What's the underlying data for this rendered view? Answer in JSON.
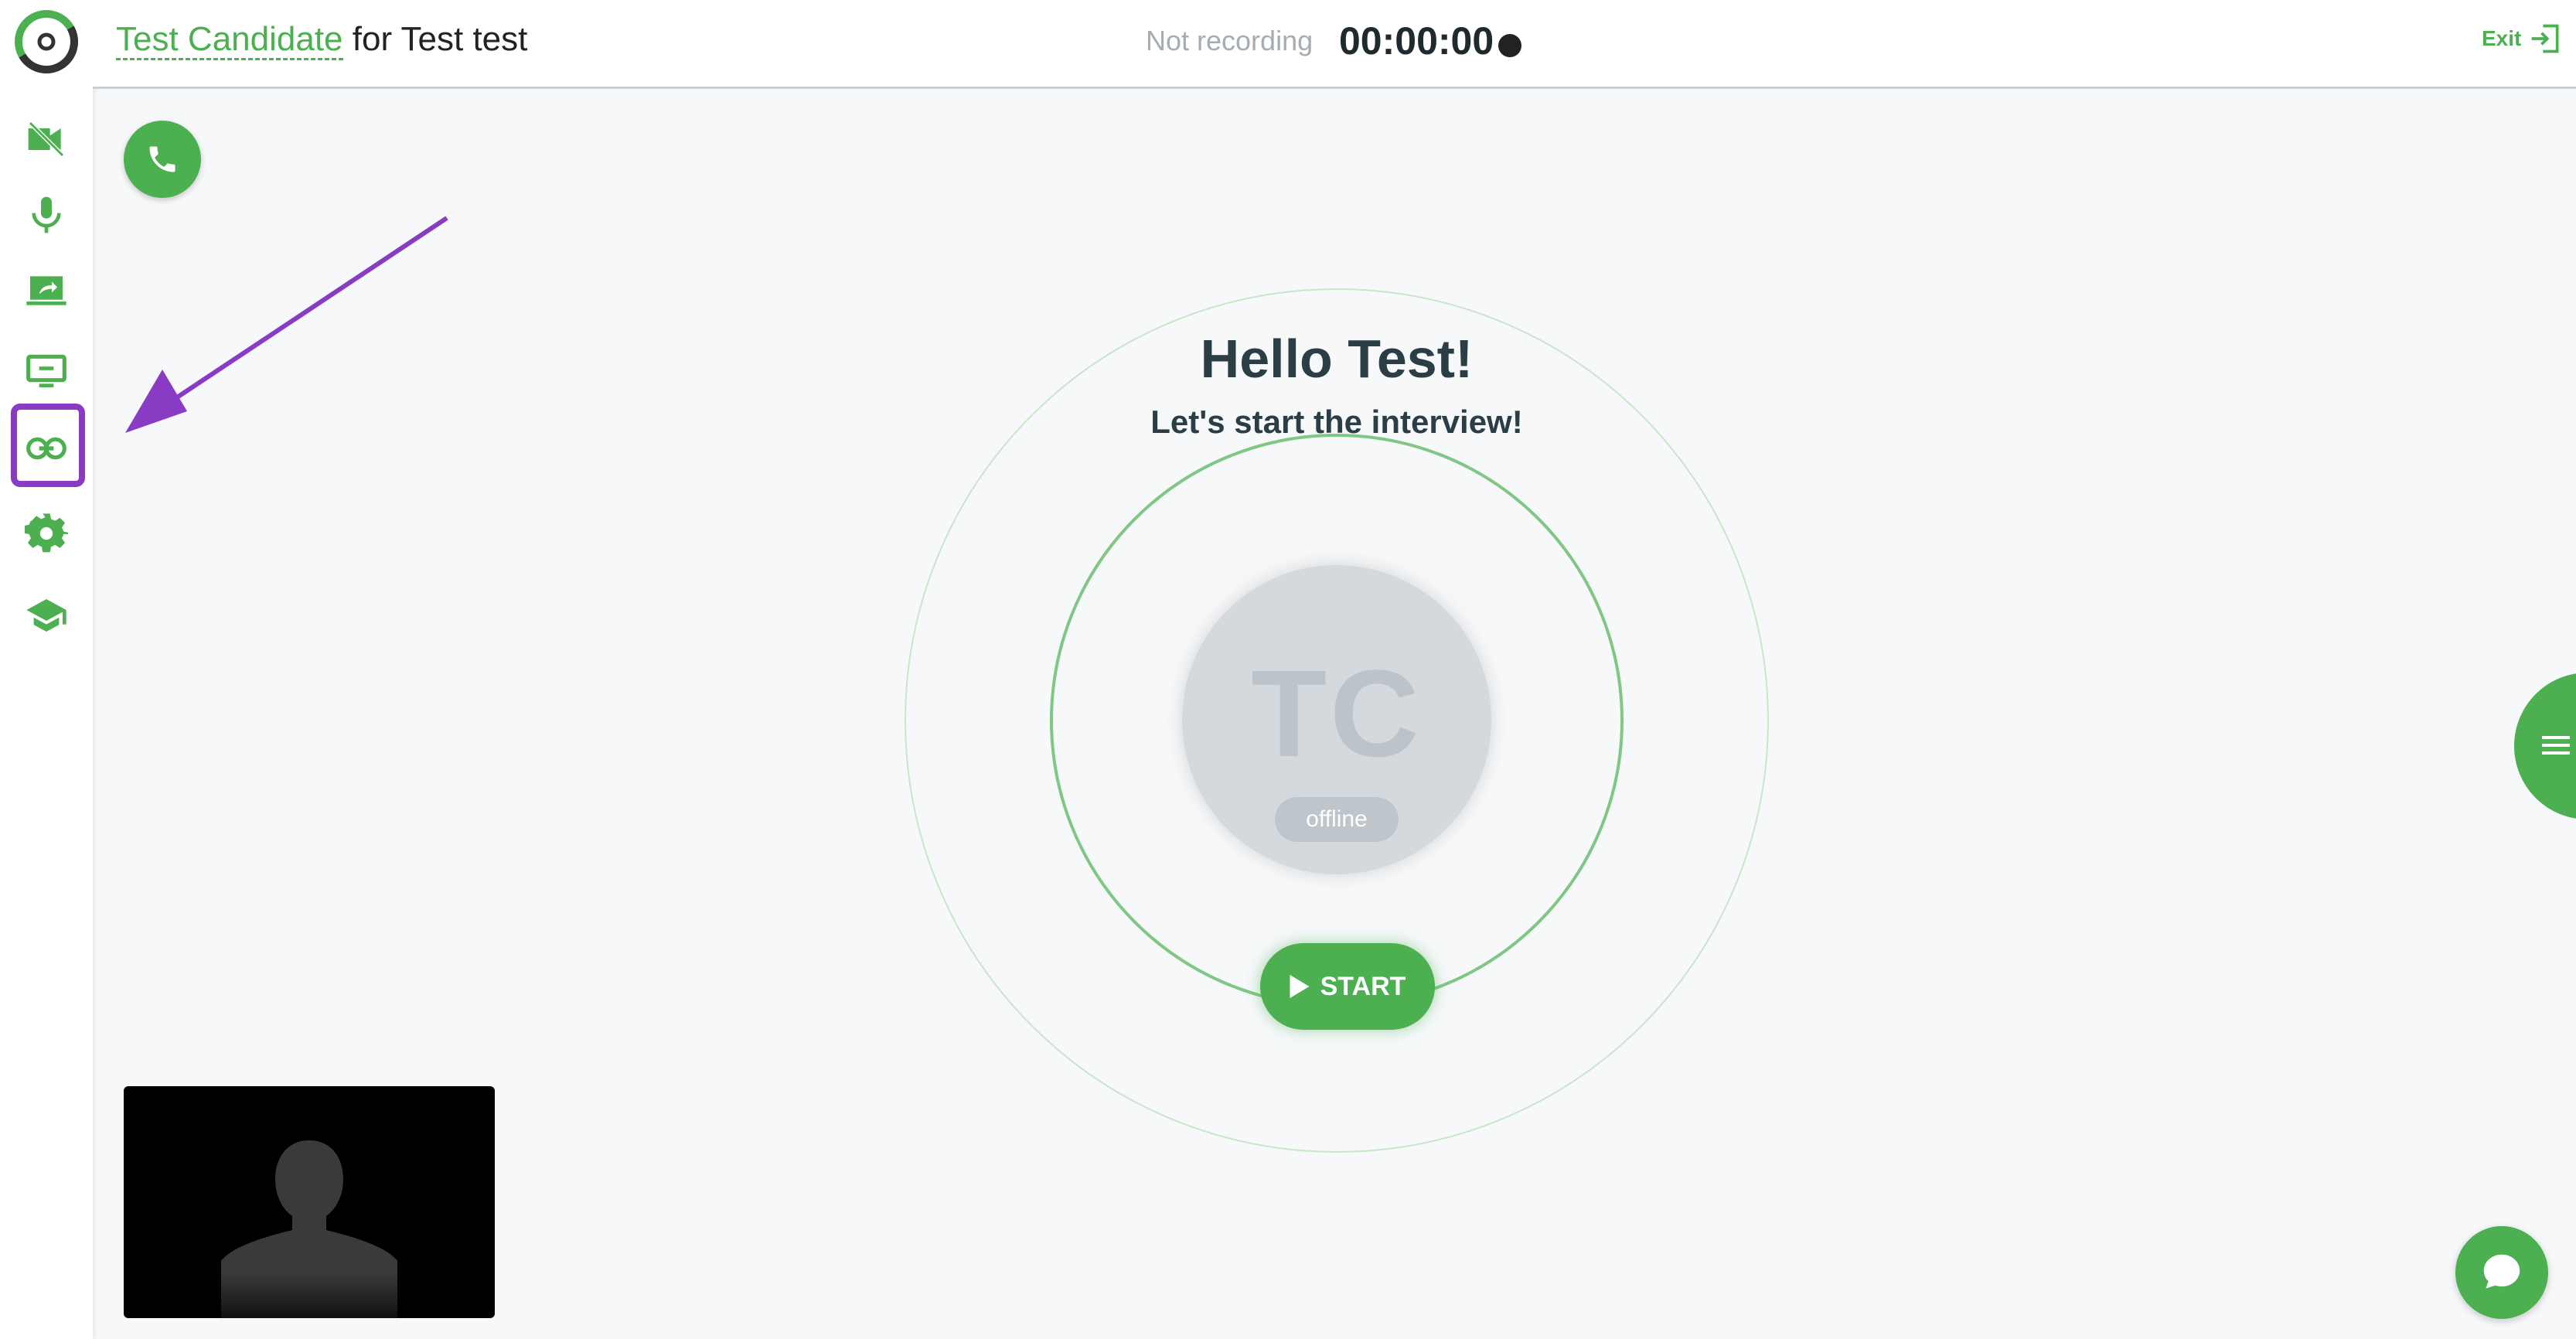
{
  "header": {
    "candidate_name": "Test Candidate",
    "title_rest": " for Test test",
    "recording_status": "Not recording",
    "timer": "00:00:00",
    "exit_label": "Exit"
  },
  "main": {
    "greeting": "Hello Test!",
    "subtitle": "Let's start the interview!",
    "avatar_initials": "TC",
    "participant_status": "offline",
    "start_label": "START"
  },
  "sidebar": {
    "icons": [
      "camera-off-icon",
      "microphone-icon",
      "screen-share-icon",
      "presentation-icon",
      "link-icon",
      "gear-icon",
      "graduation-cap-icon"
    ],
    "highlighted": "link-icon"
  },
  "colors": {
    "accent": "#4caf50",
    "highlight": "#8a3bc4",
    "background": "#f6f8fa"
  }
}
